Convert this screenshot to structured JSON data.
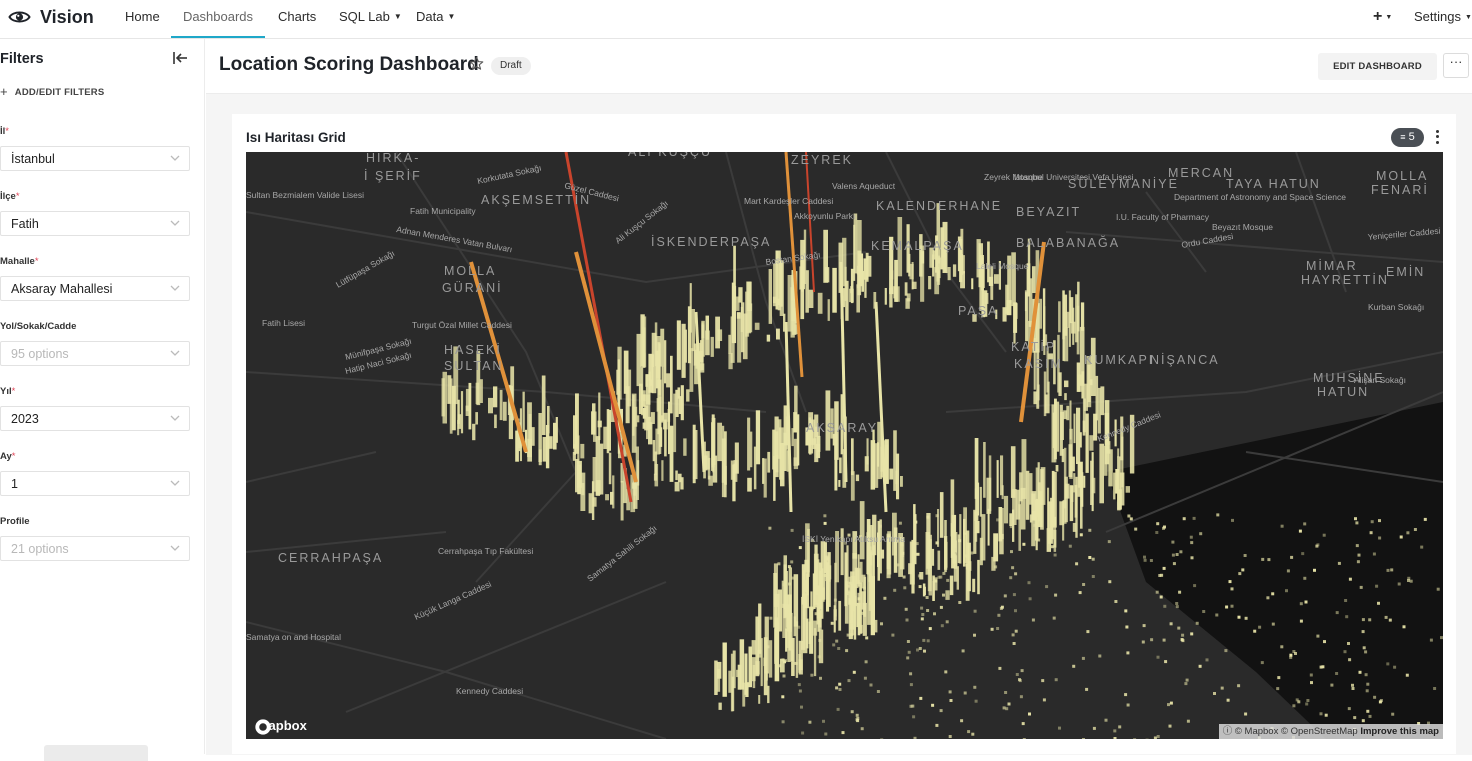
{
  "brand": {
    "name": "Vision"
  },
  "nav": {
    "items": [
      {
        "label": "Home"
      },
      {
        "label": "Dashboards",
        "active": true
      },
      {
        "label": "Charts"
      },
      {
        "label": "SQL Lab",
        "dropdown": true
      },
      {
        "label": "Data",
        "dropdown": true
      }
    ],
    "plus_label": "+",
    "settings_label": "Settings"
  },
  "filters": {
    "title": "Filters",
    "add_label": "ADD/EDIT FILTERS",
    "fields": [
      {
        "label": "İl",
        "required": true,
        "value": "İstanbul"
      },
      {
        "label": "İlçe",
        "required": true,
        "value": "Fatih"
      },
      {
        "label": "Mahalle",
        "required": true,
        "value": "Aksaray Mahallesi"
      },
      {
        "label": "Yol/Sokak/Cadde",
        "required": false,
        "placeholder": "95 options"
      },
      {
        "label": "Yıl",
        "required": true,
        "value": "2023"
      },
      {
        "label": "Ay",
        "required": true,
        "value": "1"
      },
      {
        "label": "Profile",
        "required": false,
        "placeholder": "21 options"
      }
    ]
  },
  "dashboard": {
    "title": "Location Scoring Dashboard",
    "status": "Draft",
    "edit_label": "EDIT DASHBOARD",
    "more_label": "···"
  },
  "chart": {
    "title": "Isı Haritası Grid",
    "filter_count": "5",
    "map_labels": [
      "HIRKA-",
      "İ ŞERİF",
      "ALİ KUŞÇU",
      "ZEYREK",
      "SÜLEYMANİYE",
      "MERCAN",
      "TAYA HATUN",
      "AKŞEMSETTİN",
      "KALENDERHANE",
      "BEYAZIT",
      "MOLLA",
      "FENARİ",
      "İSKENDERPAŞA",
      "KEMALPAŞA",
      "BALABANAĞA",
      "MOLLA",
      "GÜRANİ",
      "MİMAR",
      "HAYRETTİN",
      "EMİN",
      "PAŞA",
      "HASEKİ",
      "SULTAN",
      "KATİP",
      "KASIM",
      "KUMKAPI",
      "NİŞANCA",
      "MUHSİNE",
      "HATUN",
      "CERRAHPAŞA",
      "AKSARAY"
    ],
    "street_labels": [
      "Adnan Menderes Vatan Bulvarı",
      "Turgut Özal Millet Caddesi",
      "Kennedy Caddesi",
      "Kennedy Caddesi",
      "Küçük Langa Caddesi",
      "Samatya Sahili Sokağı",
      "Cerrahpaşa Tıp Fakültesi",
      "İSKİ Yenikapı Atıksu Arıtma",
      "Fatih Municipality",
      "Valens Aqueduct",
      "Ordu Caddesi",
      "Kurban Sokağı",
      "Alişan Sokağı",
      "Münifpaşa Sokağı",
      "Hatip Naci Sokağı",
      "Laleli Mosque",
      "Bostan Sokağı",
      "Ali Kuşçu Sokağı",
      "Lütfüpaşa Sokağı",
      "Güzel Caddesi",
      "Korkutata Sokağı",
      "Mart Kardeşler Caddesi",
      "Akkoyunlu Parkı",
      "Istanbul Universitesi Vefa Lisesi",
      "Zeyrek Mosque",
      "Department of Astronomy and Space Science",
      "I.U. Faculty of Pharmacy",
      "Beyazıt Mosque",
      "Yeniçeriler Caddesi",
      "Samatya on and Hospital",
      "Fatih Lisesi",
      "Sultan Bezmialem Valide Lisesi"
    ],
    "map_brand": "mapbox",
    "attribution_mapbox": "© Mapbox",
    "attribution_osm": "© OpenStreetMap",
    "attribution_improve": "Improve this map"
  },
  "colors": {
    "accent": "#1fa8c9",
    "heat_low": "#e8e4a8",
    "heat_mid": "#e0913a",
    "heat_high": "#c9442c",
    "map_bg": "#2b2b2b"
  }
}
